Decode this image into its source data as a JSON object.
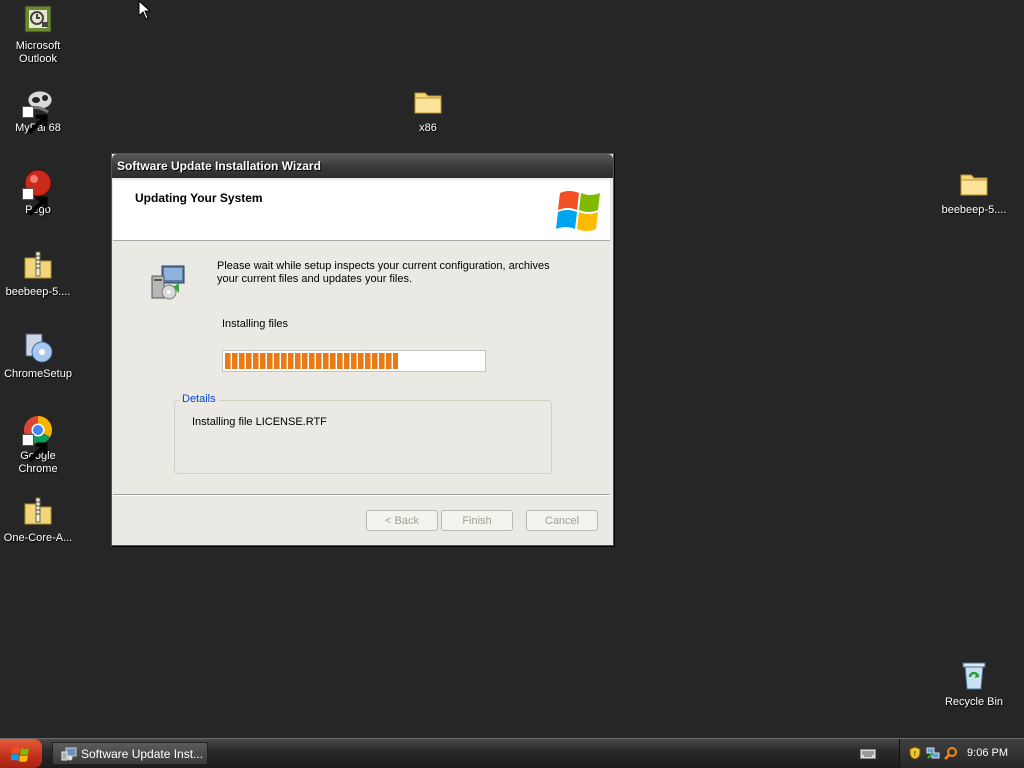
{
  "desktop": {
    "icons": [
      {
        "label": "Microsoft Outlook",
        "icon": "outlook-icon"
      },
      {
        "label": "MyPal 68",
        "icon": "mypal-icon"
      },
      {
        "label": "Pego",
        "icon": "pego-icon"
      },
      {
        "label": "beebeep-5....",
        "icon": "zip-folder-icon"
      },
      {
        "label": "ChromeSetup",
        "icon": "chrome-setup-icon"
      },
      {
        "label": "Google Chrome",
        "icon": "chrome-icon"
      },
      {
        "label": "One-Core-A...",
        "icon": "zip-folder-icon"
      },
      {
        "label": "x86",
        "icon": "folder-icon"
      },
      {
        "label": "beebeep-5....",
        "icon": "folder-icon"
      },
      {
        "label": "Recycle Bin",
        "icon": "recycle-bin-icon"
      }
    ]
  },
  "wizard": {
    "title": "Software Update Installation Wizard",
    "header_title": "Updating Your System",
    "description": "Please wait while setup inspects your current configuration, archives your current files and updates your files.",
    "status": "Installing files",
    "progress_fraction": 0.67,
    "details_label": "Details",
    "details_text": "Installing file LICENSE.RTF",
    "buttons": {
      "back": "< Back",
      "finish": "Finish",
      "cancel": "Cancel"
    }
  },
  "taskbar": {
    "task_label": "Software Update Inst...",
    "clock": "9:06 PM"
  },
  "colors": {
    "desktop_bg": "#262626",
    "progress_orange": "#e87a1a",
    "details_label_blue": "#0046d5"
  }
}
